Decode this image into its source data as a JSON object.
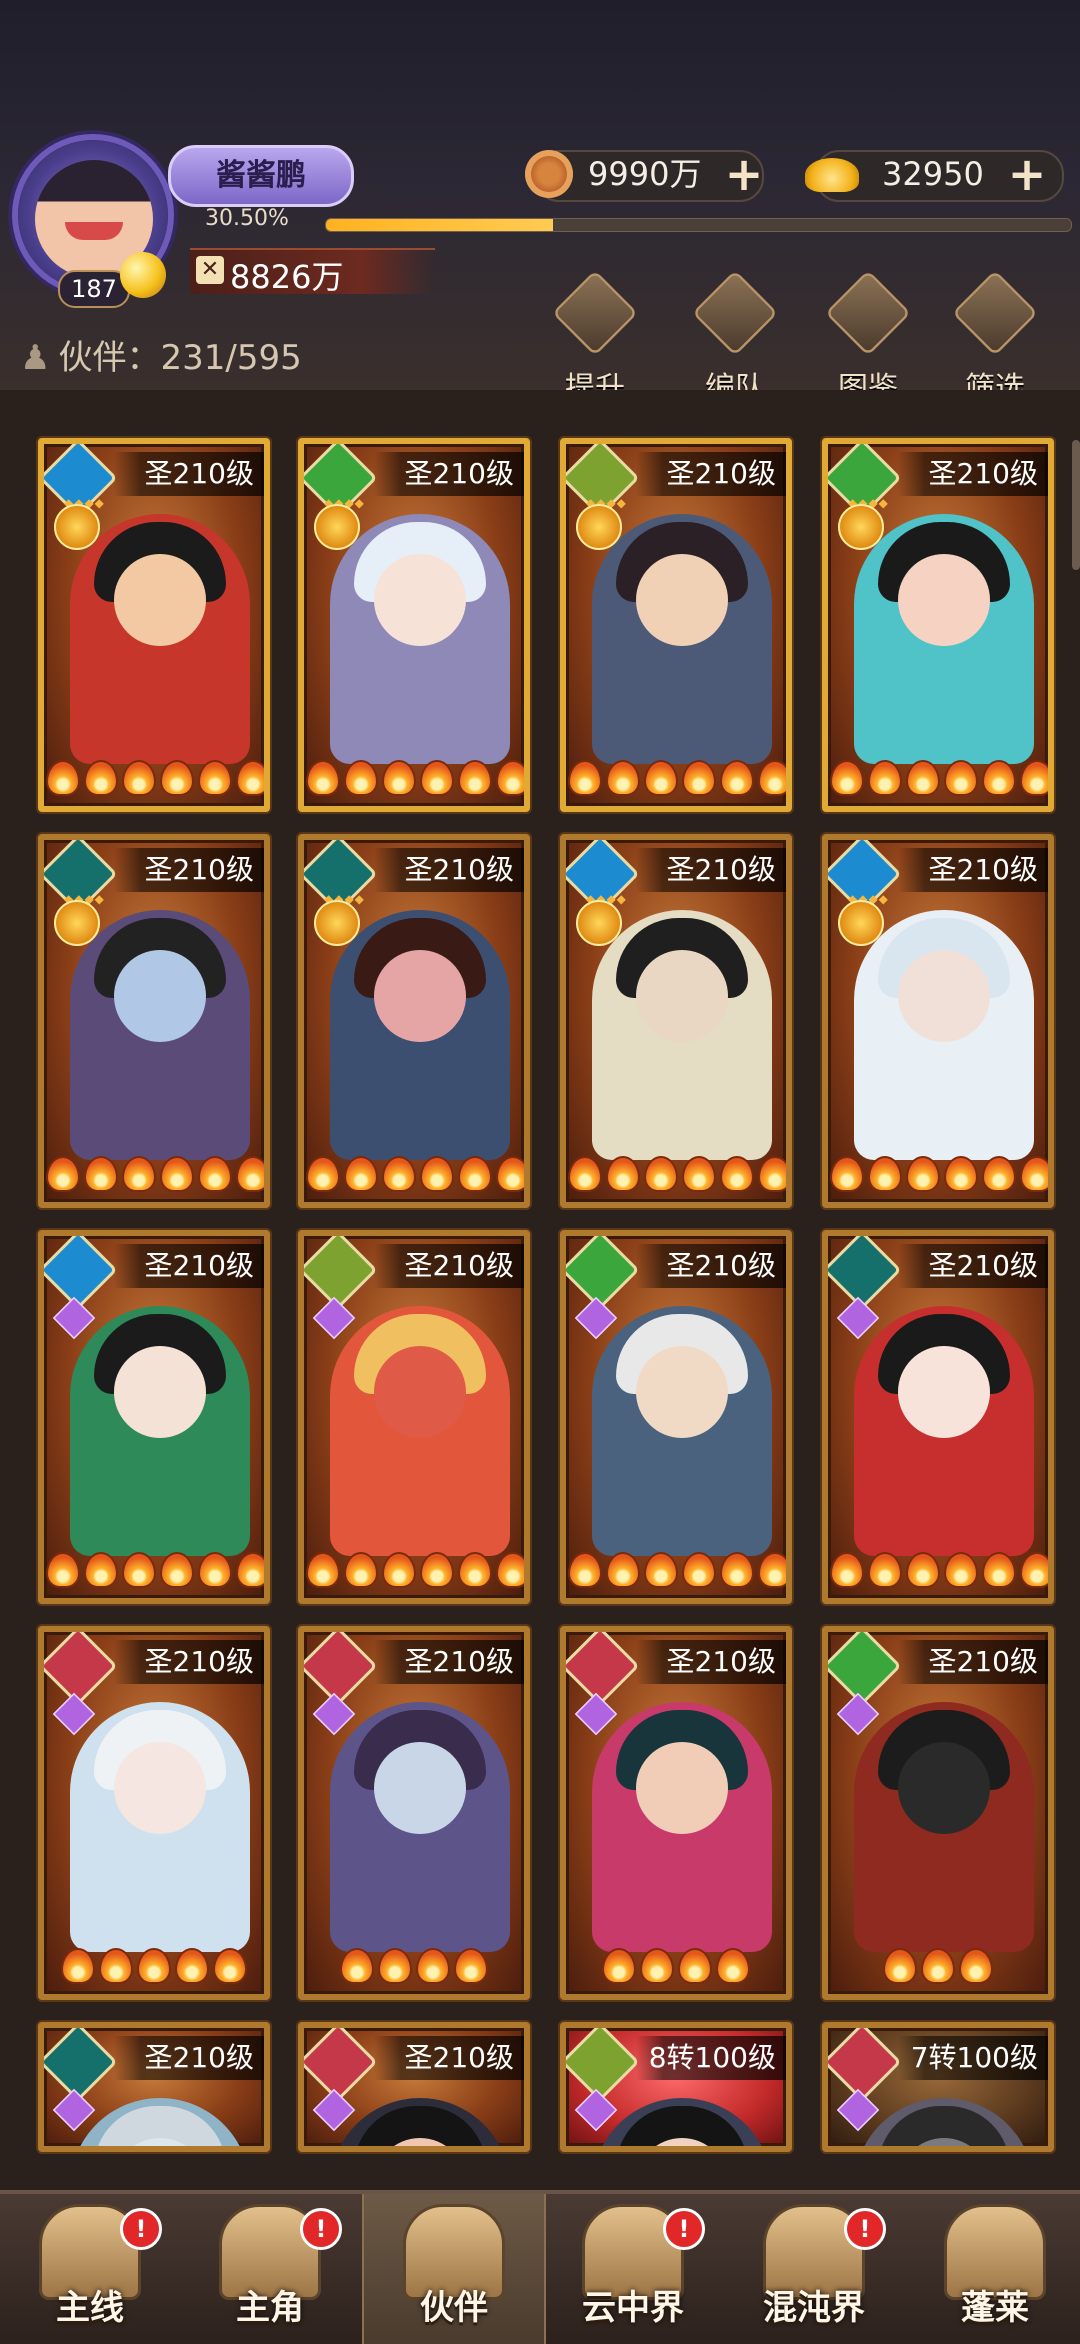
{
  "player": {
    "name": "酱酱鹏",
    "level": "187",
    "exp_percent": "30.50%",
    "power": "8826万"
  },
  "currency": {
    "copper": "9990万",
    "gold": "32950"
  },
  "partners": {
    "label": "伙伴：231/595"
  },
  "toolbar": [
    "提升",
    "编队",
    "图鉴",
    "筛选"
  ],
  "cards": [
    {
      "level": "圣210级",
      "element": "water",
      "elem_color": "#1c8bd0"
    },
    {
      "level": "圣210级",
      "element": "wind",
      "elem_color": "#3aa63c"
    },
    {
      "level": "圣210级",
      "element": "earth",
      "elem_color": "#7ea230"
    },
    {
      "level": "圣210级",
      "element": "wind",
      "elem_color": "#3aa63c"
    },
    {
      "level": "圣210级",
      "element": "dark",
      "elem_color": "#15706c"
    },
    {
      "level": "圣210级",
      "element": "dark",
      "elem_color": "#15706c"
    },
    {
      "level": "圣210级",
      "element": "water",
      "elem_color": "#1c8bd0"
    },
    {
      "level": "圣210级",
      "element": "water",
      "elem_color": "#1c8bd0"
    },
    {
      "level": "圣210级",
      "element": "water",
      "elem_color": "#1c8bd0"
    },
    {
      "level": "圣210级",
      "element": "earth",
      "elem_color": "#7ea230"
    },
    {
      "level": "圣210级",
      "element": "wind",
      "elem_color": "#3aa63c"
    },
    {
      "level": "圣210级",
      "element": "dark",
      "elem_color": "#15706c"
    },
    {
      "level": "圣210级",
      "element": "fire",
      "elem_color": "#c5384a"
    },
    {
      "level": "圣210级",
      "element": "fire",
      "elem_color": "#c5384a"
    },
    {
      "level": "圣210级",
      "element": "fire",
      "elem_color": "#c5384a"
    },
    {
      "level": "圣210级",
      "element": "wind",
      "elem_color": "#3aa63c"
    },
    {
      "level": "圣210级",
      "element": "dark",
      "elem_color": "#15706c"
    },
    {
      "level": "圣210级",
      "element": "fire",
      "elem_color": "#c5384a"
    },
    {
      "level": "8转100级",
      "element": "earth",
      "elem_color": "#7ea230"
    },
    {
      "level": "7转100级",
      "element": "fire",
      "elem_color": "#c5384a"
    }
  ],
  "nav": [
    {
      "label": "主线",
      "alert": "!"
    },
    {
      "label": "主角",
      "alert": "!"
    },
    {
      "label": "伙伴",
      "alert": ""
    },
    {
      "label": "云中界",
      "alert": "!"
    },
    {
      "label": "混沌界",
      "alert": "!"
    },
    {
      "label": "蓬莱",
      "alert": ""
    }
  ]
}
